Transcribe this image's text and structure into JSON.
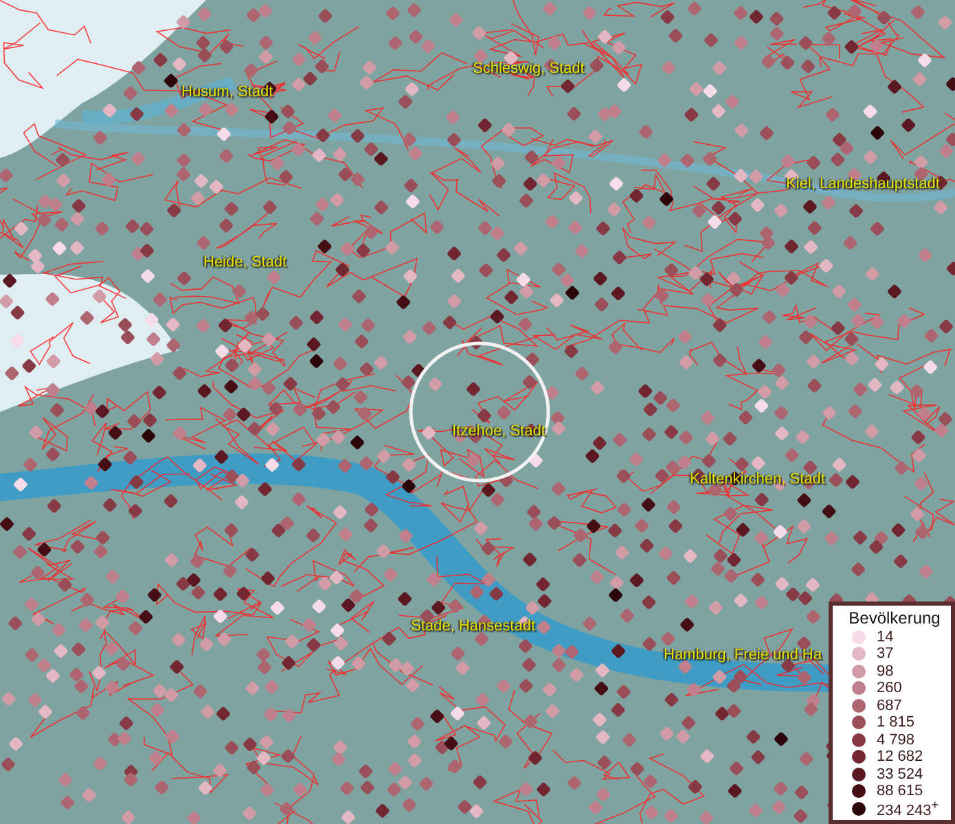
{
  "map": {
    "places": [
      {
        "name": "Husum, Stadt"
      },
      {
        "name": "Schleswig, Stadt"
      },
      {
        "name": "Kiel, Landeshauptstadt"
      },
      {
        "name": "Heide, Stadt"
      },
      {
        "name": "Itzehoe, Stadt"
      },
      {
        "name": "Kaltenkirchen, Stadt"
      },
      {
        "name": "Stade, Hansestadt"
      },
      {
        "name": "Hamburg, Freie und Ha"
      }
    ]
  },
  "legend": {
    "title": "Bevölkerung",
    "items": [
      {
        "label": "14",
        "color": "#f5dce8"
      },
      {
        "label": "37",
        "color": "#e3b8c2"
      },
      {
        "label": "98",
        "color": "#d19ca6"
      },
      {
        "label": "260",
        "color": "#c0808b"
      },
      {
        "label": "687",
        "color": "#ad6670"
      },
      {
        "label": "1 815",
        "color": "#9a4e58"
      },
      {
        "label": "4 798",
        "color": "#873a44"
      },
      {
        "label": "12 682",
        "color": "#722630"
      },
      {
        "label": "33 524",
        "color": "#5c1820"
      },
      {
        "label": "88 615",
        "color": "#450d14"
      },
      {
        "label": "234 243$^{+}$",
        "color": "#2c0509"
      }
    ]
  }
}
